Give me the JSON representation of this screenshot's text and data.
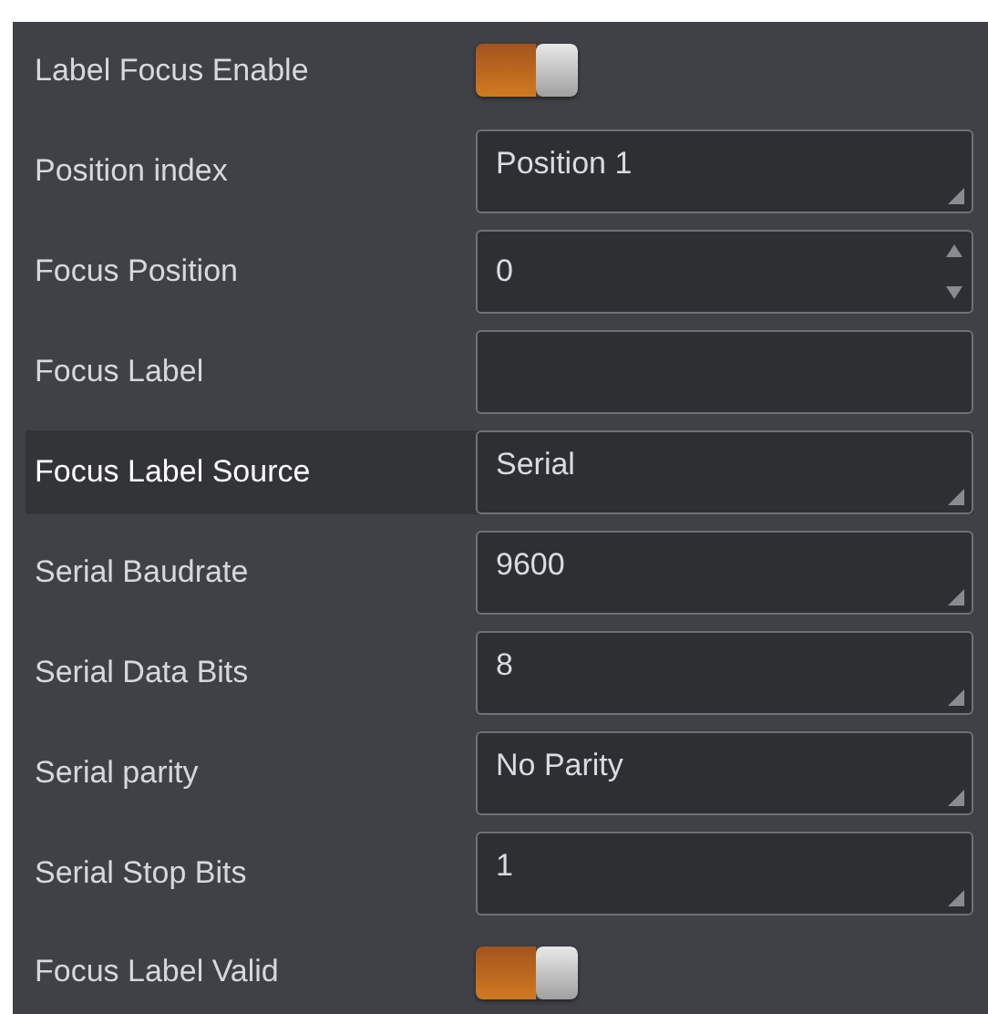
{
  "settings": [
    {
      "label": "Label Focus Enable",
      "kind": "toggle",
      "on": true,
      "selected": false
    },
    {
      "label": "Position index",
      "kind": "dropdown",
      "value": "Position 1",
      "selected": false
    },
    {
      "label": "Focus Position",
      "kind": "spinner",
      "value": "0",
      "selected": false
    },
    {
      "label": "Focus Label",
      "kind": "text",
      "selected": false
    },
    {
      "label": "Focus Label Source",
      "kind": "dropdown",
      "value": "Serial",
      "selected": true
    },
    {
      "label": "Serial Baudrate",
      "kind": "dropdown",
      "value": "9600",
      "selected": false
    },
    {
      "label": "Serial Data Bits",
      "kind": "dropdown",
      "value": "8",
      "selected": false
    },
    {
      "label": "Serial parity",
      "kind": "dropdown",
      "value": "No Parity",
      "selected": false
    },
    {
      "label": "Serial Stop Bits",
      "kind": "dropdown",
      "value": "1",
      "selected": false
    },
    {
      "label": "Focus Label Valid",
      "kind": "toggle",
      "on": true,
      "selected": false
    }
  ]
}
